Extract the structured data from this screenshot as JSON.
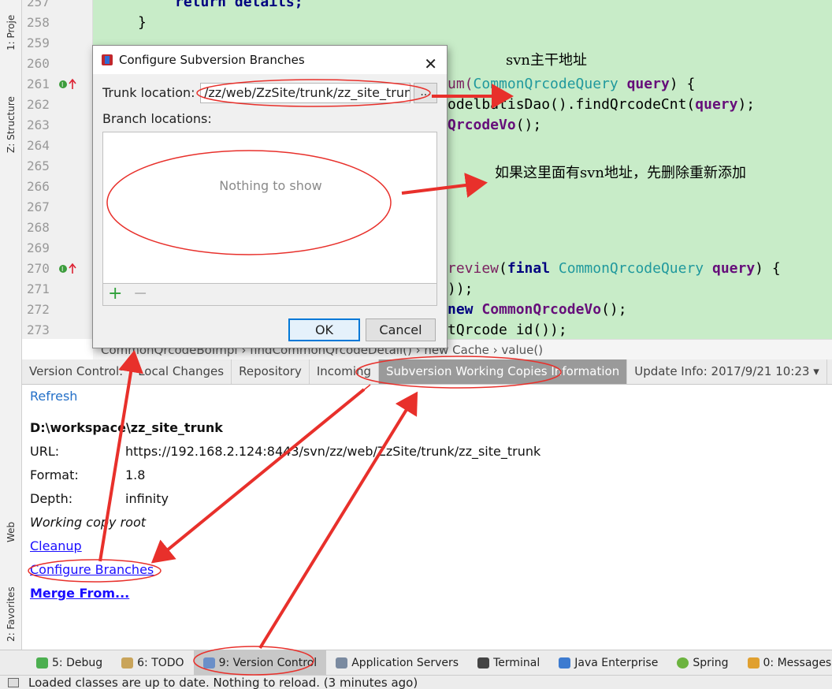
{
  "left_strip": {
    "project": "1: Proje",
    "structure": "Z: Structure",
    "web": "Web",
    "favorites": "2: Favorites"
  },
  "editor": {
    "line_numbers": [
      "257",
      "258",
      "259",
      "260",
      "261",
      "262",
      "263",
      "264",
      "265",
      "266",
      "267",
      "268",
      "269",
      "270",
      "271",
      "272",
      "273"
    ],
    "code": {
      "l257_kw": "return details;",
      "l258": "}",
      "l261_pre": "um(",
      "l261_type": "CommonQrcodeQuery",
      "l261_param": "query",
      "l261_post": ") {",
      "l262_pre": "odelbatisDao().findQrcodeCnt(",
      "l262_param": "query",
      "l262_post": ");",
      "l263_id": "QrcodeVo",
      "l263_post": "();",
      "l270_fn": "review",
      "l270_a": "(",
      "l270_kw": "final",
      "l270_type": "CommonQrcodeQuery",
      "l270_param": "query",
      "l270_post": ") {",
      "l271": "));",
      "l272_kw": "new",
      "l272_id": "CommonQrcodeVo",
      "l272_post": "();",
      "l273": "tQrcode id());"
    },
    "note_trunk": "svn主干地址",
    "note_branch": "如果这里面有svn地址，先删除重新添加"
  },
  "breadcrumb": {
    "left": "CommonQrcodeBoImpl  ›  findCommonQrcodeDetail()  ›",
    "mid": "new Cache",
    "right": "value()"
  },
  "vc_tabs": {
    "label": "Version Control:",
    "local_changes": "Local Changes",
    "repository": "Repository",
    "incoming": "Incoming",
    "working_copies": "Subversion Working Copies Information",
    "update_info": "Update Info: 2017/9/21 10:23 ▾"
  },
  "vc_content": {
    "refresh": "Refresh",
    "path": "D:\\workspace\\zz_site_trunk",
    "url_label": "URL:",
    "url_value": "https://192.168.2.124:8443/svn/zz/web/ZzSite/trunk/zz_site_trunk",
    "format_label": "Format:",
    "format_value": "1.8",
    "depth_label": "Depth:",
    "depth_value": "infinity",
    "working_copy_root": "Working copy root",
    "cleanup": "Cleanup",
    "configure_branches": "Configure Branches",
    "merge_from": "Merge From..."
  },
  "toolbar": {
    "debug": "5: Debug",
    "todo": "6: TODO",
    "version_control": "9: Version Control",
    "app_servers": "Application Servers",
    "terminal": "Terminal",
    "java_enterprise": "Java Enterprise",
    "spring": "Spring",
    "messages": "0: Messages"
  },
  "status": {
    "text": "Loaded classes are up to date. Nothing to reload. (3 minutes ago)"
  },
  "dialog": {
    "title": "Configure Subversion Branches",
    "close": "✕",
    "trunk_label": "Trunk location:",
    "trunk_value": "/zz/web/ZzSite/trunk/zz_site_trunk",
    "browse": "...",
    "branch_label": "Branch locations:",
    "empty_text": "Nothing to show",
    "add": "+",
    "remove": "−",
    "ok": "OK",
    "cancel": "Cancel"
  },
  "colors": {
    "editor_bg": "#c8ecc8",
    "annotation_red": "#e8302b"
  }
}
